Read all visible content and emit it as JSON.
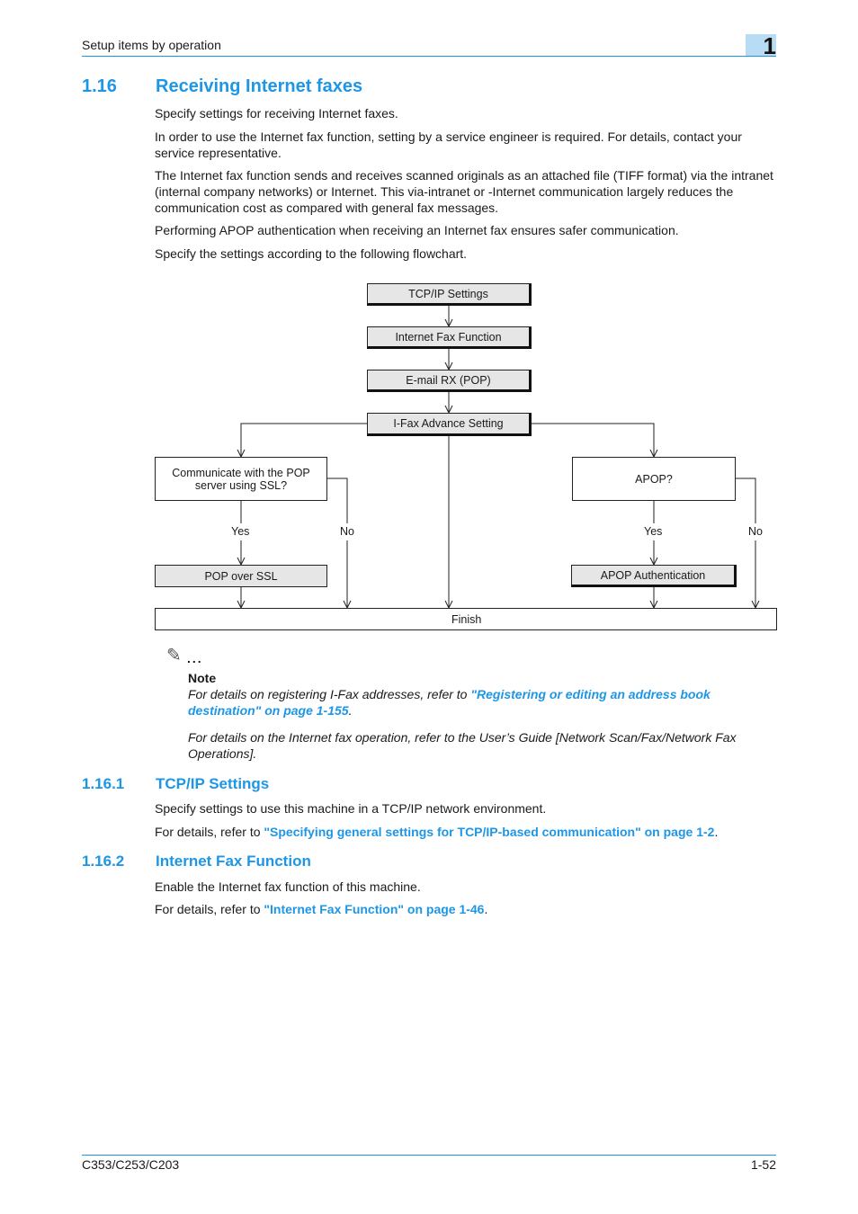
{
  "header": {
    "section": "Setup items by operation",
    "chapter": "1"
  },
  "heading": {
    "num": "1.16",
    "title": "Receiving Internet faxes"
  },
  "intro": [
    "Specify settings for receiving Internet faxes.",
    "In order to use the Internet fax function, setting by a service engineer is required. For details, contact your service representative.",
    "The Internet fax function sends and receives scanned originals as an attached file (TIFF format) via the intranet (internal company networks) or Internet. This via-intranet or -Internet communication largely reduces the communication cost as compared with general fax messages.",
    "Performing APOP authentication when receiving an Internet fax ensures safer communication.",
    "Specify the settings according to the following flowchart."
  ],
  "flowchart": {
    "tcpip": "TCP/IP Settings",
    "ifax_function": "Internet Fax Function",
    "email_rx": "E-mail RX (POP)",
    "ifax_advance": "I-Fax Advance Setting",
    "ssl_question": "Communicate with the POP server using SSL?",
    "apop_question": "APOP?",
    "yes": "Yes",
    "no": "No",
    "pop_ssl": "POP over SSL",
    "apop_auth": "APOP Authentication",
    "finish": "Finish"
  },
  "note": {
    "dots": "...",
    "title": "Note",
    "p1_pre": "For details on registering I-Fax addresses, refer to ",
    "p1_link": "\"Registering or editing an address book destination\" on page 1-155",
    "p1_post": ".",
    "p2": "For details on the Internet fax operation, refer to the User’s Guide [Network Scan/Fax/Network Fax Operations]."
  },
  "sub1": {
    "num": "1.16.1",
    "title": "TCP/IP Settings",
    "p1": "Specify settings to use this machine in a TCP/IP network environment.",
    "p2_pre": "For details, refer to ",
    "p2_link": "\"Specifying general settings for TCP/IP-based communication\" on page 1-2",
    "p2_post": "."
  },
  "sub2": {
    "num": "1.16.2",
    "title": "Internet Fax Function",
    "p1": "Enable the Internet fax function of this machine.",
    "p2_pre": "For details, refer to ",
    "p2_link": "\"Internet Fax Function\" on page 1-46",
    "p2_post": "."
  },
  "footer": {
    "model": "C353/C253/C203",
    "page": "1-52"
  }
}
